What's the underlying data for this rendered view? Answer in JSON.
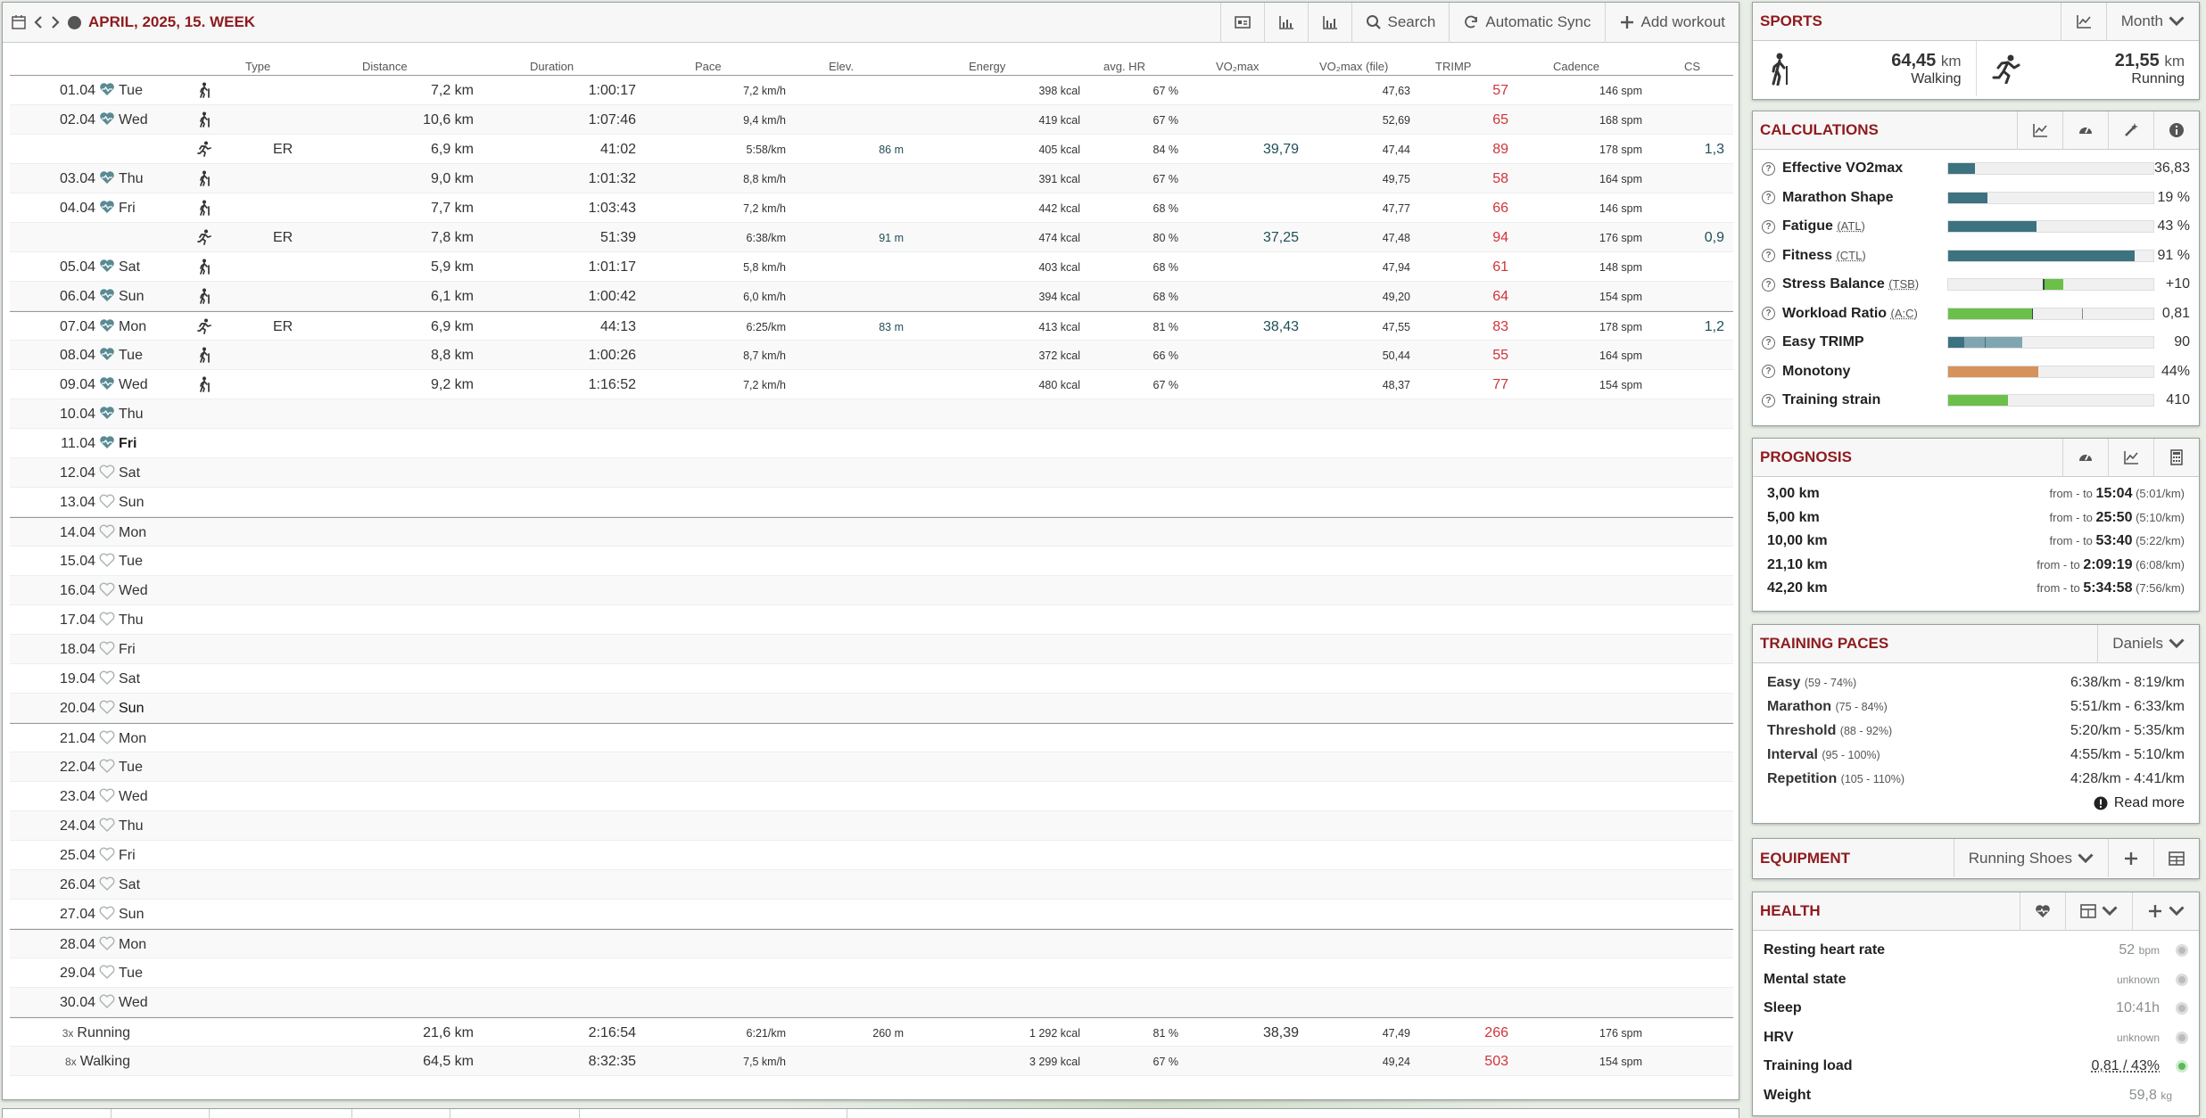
{
  "calendar": {
    "period": "APRIL, 2025, 15. WEEK",
    "toolbar": {
      "search": "Search",
      "sync": "Automatic Sync",
      "add": "Add workout"
    }
  },
  "columns": [
    "Type",
    "Distance",
    "Duration",
    "Pace",
    "Elev.",
    "Energy",
    "avg. HR",
    "VO₂max",
    "VO₂max (file)",
    "TRIMP",
    "Cadence",
    "CS"
  ],
  "rows": [
    {
      "date": "01.04",
      "dow": "Tue",
      "h": 1,
      "sport": "walk",
      "type": "",
      "dist": "7,2 km",
      "dur": "1:00:17",
      "pace": "7,2 km/h",
      "elev": "",
      "energy": "398 kcal",
      "hr": "67 %",
      "vo2": "",
      "vo2f": "47,63",
      "trimp": "57",
      "cad": "146 spm",
      "cs": ""
    },
    {
      "date": "02.04",
      "dow": "Wed",
      "h": 1,
      "sport": "walk",
      "type": "",
      "dist": "10,6 km",
      "dur": "1:07:46",
      "pace": "9,4 km/h",
      "elev": "",
      "energy": "419 kcal",
      "hr": "67 %",
      "vo2": "",
      "vo2f": "52,69",
      "trimp": "65",
      "cad": "168 spm",
      "cs": ""
    },
    {
      "date": "",
      "dow": "",
      "h": 0,
      "sport": "run",
      "type": "ER",
      "dist": "6,9 km",
      "dur": "41:02",
      "pace": "5:58/km",
      "elev": "86 m",
      "energy": "405 kcal",
      "hr": "84 %",
      "vo2": "39,79",
      "vo2f": "47,44",
      "trimp": "89",
      "cad": "178 spm",
      "cs": "1,3"
    },
    {
      "date": "03.04",
      "dow": "Thu",
      "h": 1,
      "sport": "walk",
      "type": "",
      "dist": "9,0 km",
      "dur": "1:01:32",
      "pace": "8,8 km/h",
      "elev": "",
      "energy": "391 kcal",
      "hr": "67 %",
      "vo2": "",
      "vo2f": "49,75",
      "trimp": "58",
      "cad": "164 spm",
      "cs": ""
    },
    {
      "date": "04.04",
      "dow": "Fri",
      "h": 1,
      "sport": "walk",
      "type": "",
      "dist": "7,7 km",
      "dur": "1:03:43",
      "pace": "7,2 km/h",
      "elev": "",
      "energy": "442 kcal",
      "hr": "68 %",
      "vo2": "",
      "vo2f": "47,77",
      "trimp": "66",
      "cad": "146 spm",
      "cs": ""
    },
    {
      "date": "",
      "dow": "",
      "h": 0,
      "sport": "run",
      "type": "ER",
      "dist": "7,8 km",
      "dur": "51:39",
      "pace": "6:38/km",
      "elev": "91 m",
      "energy": "474 kcal",
      "hr": "80 %",
      "vo2": "37,25",
      "vo2f": "47,48",
      "trimp": "94",
      "cad": "176 spm",
      "cs": "0,9"
    },
    {
      "date": "05.04",
      "dow": "Sat",
      "h": 1,
      "sport": "walk",
      "type": "",
      "dist": "5,9 km",
      "dur": "1:01:17",
      "pace": "5,8 km/h",
      "elev": "",
      "energy": "403 kcal",
      "hr": "68 %",
      "vo2": "",
      "vo2f": "47,94",
      "trimp": "61",
      "cad": "148 spm",
      "cs": ""
    },
    {
      "date": "06.04",
      "dow": "Sun",
      "h": 1,
      "sport": "walk",
      "type": "",
      "dist": "6,1 km",
      "dur": "1:00:42",
      "pace": "6,0 km/h",
      "elev": "",
      "energy": "394 kcal",
      "hr": "68 %",
      "vo2": "",
      "vo2f": "49,20",
      "trimp": "64",
      "cad": "154 spm",
      "cs": ""
    },
    {
      "date": "07.04",
      "dow": "Mon",
      "h": 1,
      "sport": "run",
      "type": "ER",
      "dist": "6,9 km",
      "dur": "44:13",
      "pace": "6:25/km",
      "elev": "83 m",
      "energy": "413 kcal",
      "hr": "81 %",
      "vo2": "38,43",
      "vo2f": "47,55",
      "trimp": "83",
      "cad": "178 spm",
      "cs": "1,2",
      "wk": 1
    },
    {
      "date": "08.04",
      "dow": "Tue",
      "h": 1,
      "sport": "walk",
      "type": "",
      "dist": "8,8 km",
      "dur": "1:00:26",
      "pace": "8,7 km/h",
      "elev": "",
      "energy": "372 kcal",
      "hr": "66 %",
      "vo2": "",
      "vo2f": "50,44",
      "trimp": "55",
      "cad": "164 spm",
      "cs": ""
    },
    {
      "date": "09.04",
      "dow": "Wed",
      "h": 1,
      "sport": "walk",
      "type": "",
      "dist": "9,2 km",
      "dur": "1:16:52",
      "pace": "7,2 km/h",
      "elev": "",
      "energy": "480 kcal",
      "hr": "67 %",
      "vo2": "",
      "vo2f": "48,37",
      "trimp": "77",
      "cad": "154 spm",
      "cs": ""
    },
    {
      "date": "10.04",
      "dow": "Thu",
      "h": 1
    },
    {
      "date": "11.04",
      "dow": "Fri",
      "h": 1,
      "bold": 1
    },
    {
      "date": "12.04",
      "dow": "Sat",
      "h": 2
    },
    {
      "date": "13.04",
      "dow": "Sun",
      "h": 2
    },
    {
      "date": "14.04",
      "dow": "Mon",
      "h": 2,
      "wk": 1
    },
    {
      "date": "15.04",
      "dow": "Tue",
      "h": 2
    },
    {
      "date": "16.04",
      "dow": "Wed",
      "h": 2
    },
    {
      "date": "17.04",
      "dow": "Thu",
      "h": 2
    },
    {
      "date": "18.04",
      "dow": "Fri",
      "h": 2
    },
    {
      "date": "19.04",
      "dow": "Sat",
      "h": 2
    },
    {
      "date": "20.04",
      "dow": "Sun",
      "h": 2,
      "dark": 1
    },
    {
      "date": "21.04",
      "dow": "Mon",
      "h": 2,
      "wk": 1
    },
    {
      "date": "22.04",
      "dow": "Tue",
      "h": 2
    },
    {
      "date": "23.04",
      "dow": "Wed",
      "h": 2
    },
    {
      "date": "24.04",
      "dow": "Thu",
      "h": 2
    },
    {
      "date": "25.04",
      "dow": "Fri",
      "h": 2
    },
    {
      "date": "26.04",
      "dow": "Sat",
      "h": 2
    },
    {
      "date": "27.04",
      "dow": "Sun",
      "h": 2
    },
    {
      "date": "28.04",
      "dow": "Mon",
      "h": 2,
      "wk": 1
    },
    {
      "date": "29.04",
      "dow": "Tue",
      "h": 2
    },
    {
      "date": "30.04",
      "dow": "Wed",
      "h": 2
    }
  ],
  "summary": [
    {
      "count": "3x",
      "name": "Running",
      "dist": "21,6 km",
      "dur": "2:16:54",
      "pace": "6:21/km",
      "elev": "260 m",
      "energy": "1 292 kcal",
      "hr": "81 %",
      "vo2": "38,39",
      "vo2f": "47,49",
      "trimp": "266",
      "cad": "176 spm"
    },
    {
      "count": "8x",
      "name": "Walking",
      "dist": "64,5 km",
      "dur": "8:32:35",
      "pace": "7,5 km/h",
      "elev": "",
      "energy": "3 299 kcal",
      "hr": "67 %",
      "vo2": "",
      "vo2f": "49,24",
      "trimp": "503",
      "cad": "154 spm"
    }
  ],
  "sports": {
    "title": "SPORTS",
    "range": "Month",
    "walking": {
      "value": "64,45",
      "unit": "km",
      "label": "Walking"
    },
    "running": {
      "value": "21,55",
      "unit": "km",
      "label": "Running"
    }
  },
  "calculations": {
    "title": "CALCULATIONS",
    "items": [
      {
        "label": "Effective VO2max",
        "abbr": "",
        "value": "36,83",
        "fill": 0.13,
        "color": "#3d7280"
      },
      {
        "label": "Marathon Shape",
        "abbr": "",
        "value": "19 %",
        "fill": 0.19,
        "color": "#3d7280"
      },
      {
        "label": "Fatigue",
        "abbr": "(ATL)",
        "value": "43 %",
        "fill": 0.43,
        "color": "#3d7280"
      },
      {
        "label": "Fitness",
        "abbr": "(CTL)",
        "value": "91 %",
        "fill": 0.91,
        "color": "#3d7280"
      },
      {
        "label": "Stress Balance",
        "abbr": "(TSB)",
        "value": "+10",
        "fill": 0.1,
        "color": "#6cc04a"
      },
      {
        "label": "Workload Ratio",
        "abbr": "(A:C)",
        "value": "0,81",
        "fill": 0.41,
        "color": "#6cc04a"
      },
      {
        "label": "Easy TRIMP",
        "abbr": "",
        "value": "90",
        "fill": 0.36,
        "color": "#3d7280"
      },
      {
        "label": "Monotony",
        "abbr": "",
        "value": "44%",
        "fill": 0.44,
        "color": "#d5925a"
      },
      {
        "label": "Training strain",
        "abbr": "",
        "value": "410",
        "fill": 0.29,
        "color": "#6cc04a"
      }
    ]
  },
  "prognosis": {
    "title": "PROGNOSIS",
    "items": [
      {
        "dist": "3,00 km",
        "time": "15:04",
        "pace": "(5:01/km)"
      },
      {
        "dist": "5,00 km",
        "time": "25:50",
        "pace": "(5:10/km)"
      },
      {
        "dist": "10,00 km",
        "time": "53:40",
        "pace": "(5:22/km)"
      },
      {
        "dist": "21,10 km",
        "time": "2:09:19",
        "pace": "(6:08/km)"
      },
      {
        "dist": "42,20 km",
        "time": "5:34:58",
        "pace": "(7:56/km)"
      }
    ],
    "from": "from - to"
  },
  "paces": {
    "title": "TRAINING PACES",
    "system": "Daniels",
    "items": [
      {
        "name": "Easy",
        "range": "(59 - 74%)",
        "pace": "6:38/km - 8:19/km"
      },
      {
        "name": "Marathon",
        "range": "(75 - 84%)",
        "pace": "5:51/km - 6:33/km"
      },
      {
        "name": "Threshold",
        "range": "(88 - 92%)",
        "pace": "5:20/km - 5:35/km"
      },
      {
        "name": "Interval",
        "range": "(95 - 100%)",
        "pace": "4:55/km - 5:10/km"
      },
      {
        "name": "Repetition",
        "range": "(105 - 110%)",
        "pace": "4:28/km - 4:41/km"
      }
    ],
    "more": "Read more"
  },
  "equipment": {
    "title": "EQUIPMENT",
    "select": "Running Shoes"
  },
  "health": {
    "title": "HEALTH",
    "items": [
      {
        "label": "Resting heart rate",
        "value": "52",
        "unit": "bpm"
      },
      {
        "label": "Mental state",
        "value": "unknown",
        "unit": ""
      },
      {
        "label": "Sleep",
        "value": "10:41h",
        "unit": ""
      },
      {
        "label": "HRV",
        "value": "unknown",
        "unit": ""
      },
      {
        "label": "Training load",
        "value": "0,81 / 43%",
        "unit": ""
      },
      {
        "label": "Weight",
        "value": "59,8",
        "unit": "kg"
      }
    ]
  }
}
